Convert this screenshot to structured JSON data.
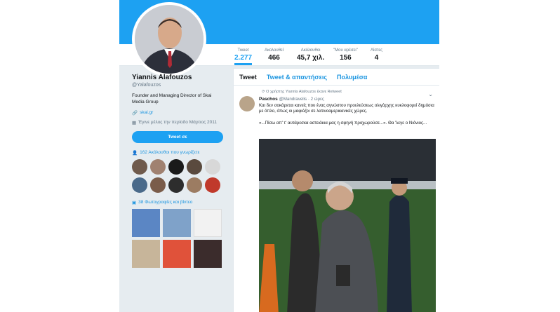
{
  "profile": {
    "name": "Yiannis Alafouzos",
    "handle": "@Yalafouzos",
    "bio": "Founder and Managing Director of Skai Media Group",
    "link": "skai.gr",
    "joined": "Έγινε μέλος την περίοδο Μάρτιος 2011",
    "tweet_to_label": "Tweet σε"
  },
  "stats": [
    {
      "label": "Tweet",
      "value": "2.277"
    },
    {
      "label": "Ακολουθεί",
      "value": "466"
    },
    {
      "label": "Ακόλουθοι",
      "value": "45,7 χιλ."
    },
    {
      "label": "\"Μου αρέσει\"",
      "value": "156"
    },
    {
      "label": "Λίστες",
      "value": "4"
    }
  ],
  "followers_known": "162 Ακόλουθοι που γνωρίζετε",
  "photos_videos": "38 Φωτογραφίες και βίντεο",
  "tabs": [
    "Tweet",
    "Tweet & απαντήσεις",
    "Πολυμέσα"
  ],
  "tweet": {
    "retweeted_by": "Ο χρήστης Yiannis Alafouzos έκανε Retweet",
    "author_name": "Paschos",
    "author_handle": "@Mandravelis · 2 ώρες",
    "text": "Και δεν σοκάρεται κανείς που ένας αγνώστου προελεύσεως ολιγάρχης κυκλοφορεί δημόσια με όπλο, όπως οι μαφιόζοι σε λατινοαμερικανικές χώρες.",
    "quote": "«...Πίσω απ' τ' αυτάρεσκα αστειάκια μας η σφηνή προχωρούσε...». Θα 'λεγε ο Νιόνιος..."
  },
  "colors": {
    "accent": "#1da1f2",
    "link": "#1b95e0",
    "background": "#e6ecf0"
  }
}
